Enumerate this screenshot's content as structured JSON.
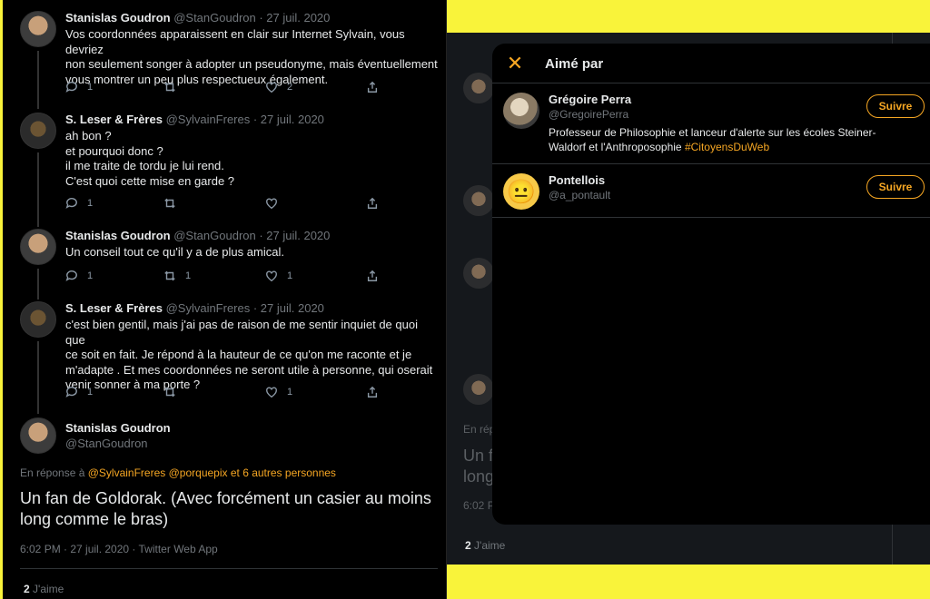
{
  "tweets": [
    {
      "name": "Stanislas Goudron",
      "meta": "@StanGoudron · 27 juil. 2020",
      "lines": [
        "Vos coordonnées apparaissent en clair sur Internet Sylvain, vous devriez",
        "non seulement songer à adopter un pseudonyme, mais éventuellement",
        "vous montrer un peu plus respectueux également."
      ],
      "reply_count": "1",
      "retweet_count": "",
      "like_count": "2"
    },
    {
      "name": "S. Leser & Frères",
      "meta": "@SylvainFreres · 27 juil. 2020",
      "lines": [
        "ah bon ?",
        "et pourquoi donc ?",
        "il me traite de tordu je lui rend.",
        "C'est quoi cette mise en garde ?"
      ],
      "reply_count": "1",
      "retweet_count": "",
      "like_count": ""
    },
    {
      "name": "Stanislas Goudron",
      "meta": "@StanGoudron · 27 juil. 2020",
      "lines": [
        "Un conseil tout ce qu'il y a de plus amical."
      ],
      "reply_count": "1",
      "retweet_count": "1",
      "like_count": "1"
    },
    {
      "name": "S. Leser & Frères",
      "meta": "@SylvainFreres · 27 juil. 2020",
      "lines": [
        "c'est bien gentil, mais j'ai pas de raison de me sentir inquiet de quoi que",
        "ce soit en fait. Je répond à la hauteur de ce qu'on me raconte et je",
        "m'adapte . Et mes coordonnées ne seront utile à personne, qui oserait",
        "venir sonner à ma porte ?"
      ],
      "reply_count": "1",
      "retweet_count": "",
      "like_count": "1"
    }
  ],
  "main_tweet": {
    "name": "Stanislas Goudron",
    "handle": "@StanGoudron",
    "reply_prefix": "En réponse à",
    "reply_link1": "@SylvainFreres",
    "reply_link2": "@porquepix",
    "reply_suffix": "et 6 autres personnes",
    "text": "Un fan de Goldorak. (Avec forcément un casier au moins long comme le bras)",
    "meta": "6:02 PM · 27 juil. 2020 · Twitter Web App",
    "likes_number": "2",
    "likes_label": "J'aime"
  },
  "background": {
    "reply_prefix_partial": "En rép",
    "text_line1_partial": "Un f",
    "text_line2_partial": "long",
    "meta_partial": "6:02 P",
    "likes_number": "2",
    "likes_label": "J'aime"
  },
  "modal": {
    "title": "Aimé par",
    "users": [
      {
        "name": "Grégoire Perra",
        "handle": "@GregoirePerra",
        "bio_text": "Professeur de Philosophie et lanceur d'alerte sur les écoles Steiner-Waldorf et l'Anthroposophie",
        "bio_tag": "#CitoyensDuWeb",
        "follow_label": "Suivre"
      },
      {
        "name": "Pontellois",
        "handle": "@a_pontault",
        "avatar_emoji": "😐",
        "follow_label": "Suivre"
      }
    ]
  },
  "colors": {
    "accent": "#f5a623",
    "background": "#000000",
    "highlight": "#f9f33a"
  }
}
